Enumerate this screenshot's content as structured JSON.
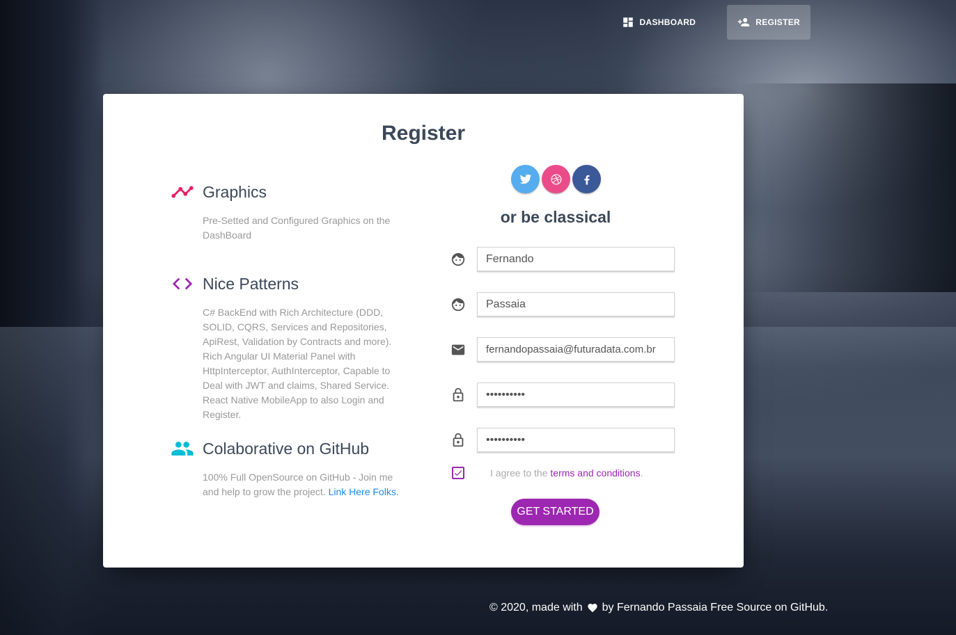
{
  "nav": {
    "items": [
      {
        "label": "DASHBOARD",
        "icon": "dashboard-icon"
      },
      {
        "label": "REGISTER",
        "icon": "person-add-icon",
        "active": true
      }
    ]
  },
  "card": {
    "title": "Register",
    "features": [
      {
        "icon": "timeline-icon",
        "icon_color": "#e91e63",
        "title": "Graphics",
        "description": "Pre-Setted and Configured Graphics on the DashBoard"
      },
      {
        "icon": "code-icon",
        "icon_color": "#9c27b0",
        "title": "Nice Patterns",
        "description": "C# BackEnd with Rich Architecture (DDD, SOLID, CQRS, Services and Repositories, ApiRest, Validation by Contracts and more). Rich Angular UI Material Panel with HttpInterceptor, AuthInterceptor, Capable to Deal with JWT and claims, Shared Service. React Native MobileApp to also Login and Register."
      },
      {
        "icon": "people-icon",
        "icon_color": "#00bcd4",
        "title": "Colaborative on GitHub",
        "description": "100% Full OpenSource on GitHub - Join me and help to grow the project.",
        "link": "Link Here Folks."
      }
    ],
    "social": [
      {
        "name": "twitter",
        "icon": "twitter-icon",
        "color": "#55acee"
      },
      {
        "name": "dribbble",
        "icon": "dribbble-icon",
        "color": "#ea4c89"
      },
      {
        "name": "facebook",
        "icon": "facebook-icon",
        "color": "#3b5998"
      }
    ],
    "classical_text": "or be classical",
    "fields": {
      "first_name": "Fernando",
      "last_name": "Passaia",
      "email": "fernandopassaia@futuradata.com.br",
      "password": "••••••••••",
      "confirm_password": "••••••••••"
    },
    "agree": {
      "checked": true,
      "prefix": "I agree to the",
      "link": "terms and conditions",
      "suffix": "."
    },
    "submit_label": "GET STARTED"
  },
  "footer": {
    "prefix": "© 2020, made with",
    "suffix": "by Fernando Passaia Free Source on GitHub."
  },
  "colors": {
    "primary": "#9c27b0",
    "heading": "#3c4858",
    "muted": "#999999",
    "link": "#1e88e5"
  }
}
